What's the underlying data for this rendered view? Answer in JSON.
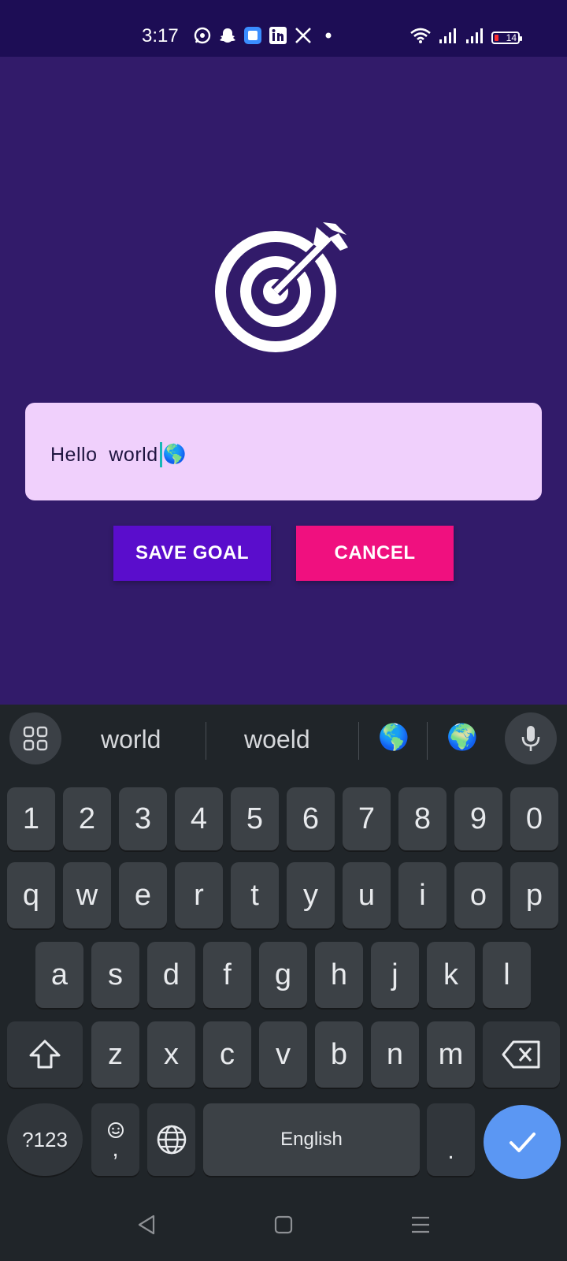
{
  "status_bar": {
    "time": "3:17",
    "left_icons": [
      "whatsapp-icon",
      "snapchat-icon",
      "app-icon",
      "linkedin-icon",
      "x-icon",
      "dot-icon"
    ],
    "right_icons": [
      "wifi-icon",
      "signal-icon",
      "signal-icon"
    ],
    "battery": "14"
  },
  "main": {
    "icon": "target-arrow-icon",
    "goal_input": {
      "value": "Hello  world",
      "emoji": "🌎"
    },
    "save_button": "SAVE GOAL",
    "cancel_button": "CANCEL",
    "save_color": "#5a0dcc",
    "cancel_color": "#f0107f",
    "background": "#321b6a"
  },
  "keyboard": {
    "suggestions": [
      "world",
      "woeld",
      "🌎",
      "🌍"
    ],
    "row_numbers": [
      "1",
      "2",
      "3",
      "4",
      "5",
      "6",
      "7",
      "8",
      "9",
      "0"
    ],
    "row1": [
      "q",
      "w",
      "e",
      "r",
      "t",
      "y",
      "u",
      "i",
      "o",
      "p"
    ],
    "row2": [
      "a",
      "s",
      "d",
      "f",
      "g",
      "h",
      "j",
      "k",
      "l"
    ],
    "row3": [
      "z",
      "x",
      "c",
      "v",
      "b",
      "n",
      "m"
    ],
    "symbols_key": "?123",
    "emoji_comma_key": ",",
    "space_label": "English",
    "period_key": ".",
    "enter_color": "#5b97f3"
  },
  "nav_bar": {
    "items": [
      "back-icon",
      "home-icon",
      "recents-icon"
    ]
  }
}
